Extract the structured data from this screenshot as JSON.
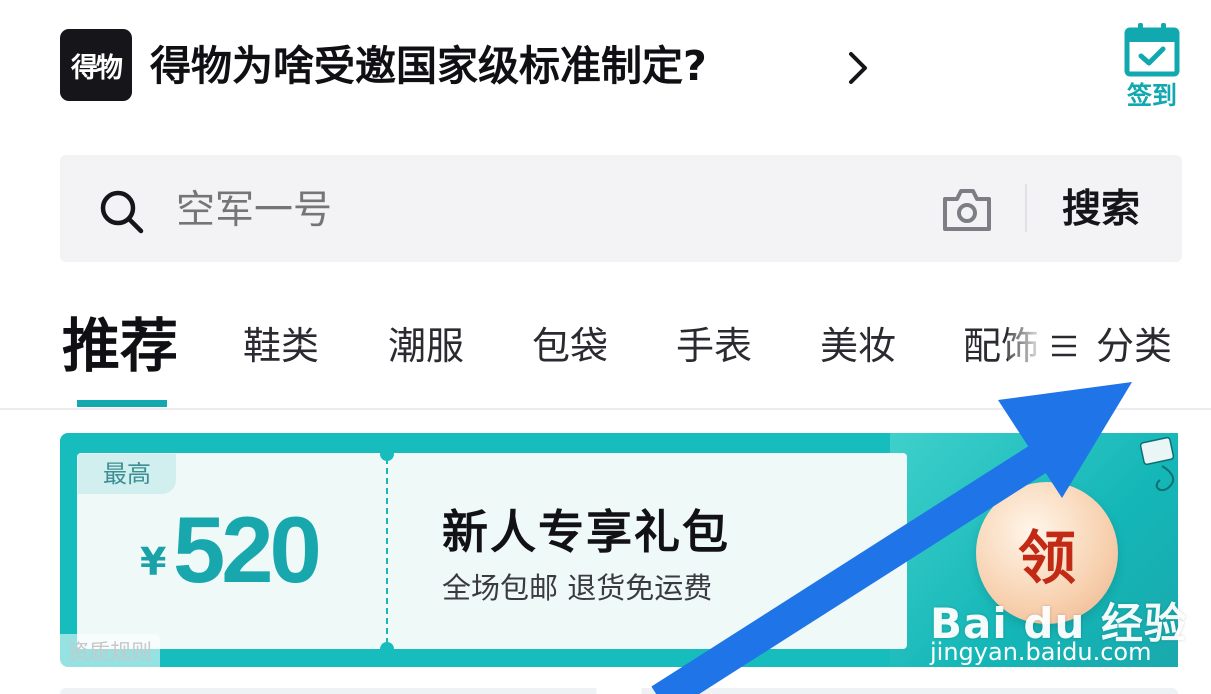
{
  "header": {
    "logo_text": "得物",
    "headline": "得物为啥受邀国家级标准制定?",
    "checkin_label": "签到"
  },
  "search": {
    "placeholder": "空军一号",
    "button_label": "搜索"
  },
  "tabs": {
    "items": [
      {
        "label": "推荐",
        "active": true
      },
      {
        "label": "鞋类"
      },
      {
        "label": "潮服"
      },
      {
        "label": "包袋"
      },
      {
        "label": "手表"
      },
      {
        "label": "美妆"
      },
      {
        "label": "配饰"
      }
    ],
    "category_label": "分类"
  },
  "promo": {
    "max_tag": "最高",
    "currency": "¥",
    "amount": "520",
    "title": "新人专享礼包",
    "subtitle": "全场包邮 退货免运费",
    "claim_label": "领",
    "qualification_link": "资质规则"
  },
  "watermark": {
    "brand": "Bai du 经验",
    "url": "jingyan.baidu.com"
  },
  "colors": {
    "accent": "#12a8b0",
    "promo_bg": "#17bdbd",
    "annotation_arrow": "#1f74e8",
    "claim_text": "#c32a16"
  }
}
